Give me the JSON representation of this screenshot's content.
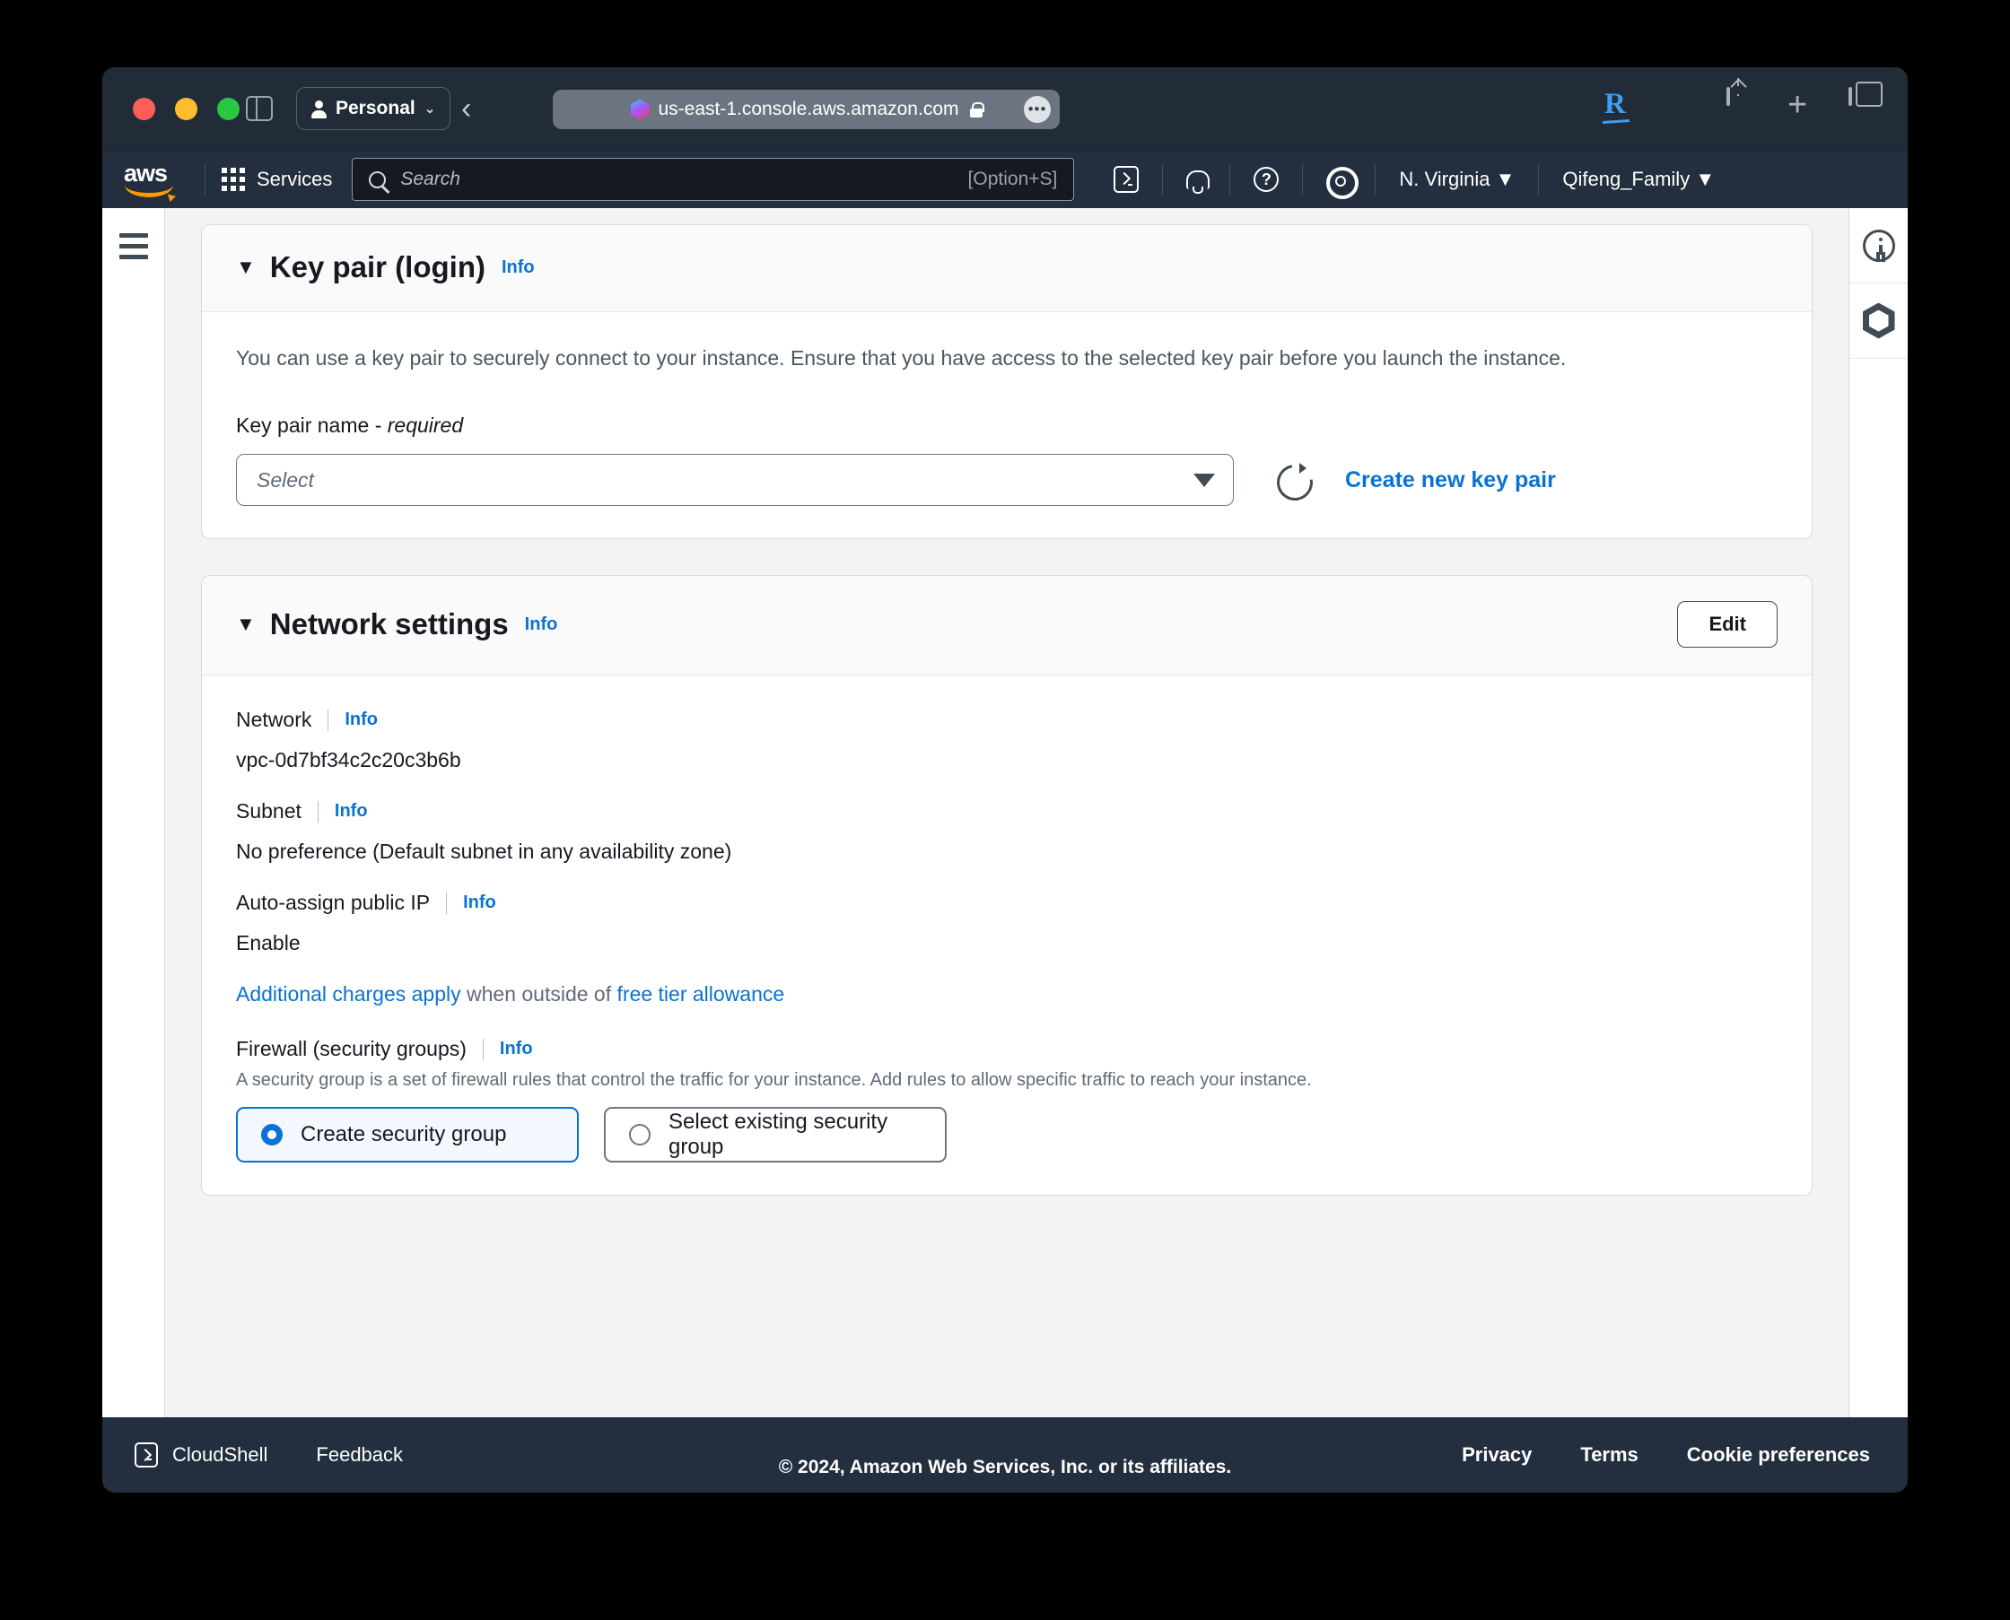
{
  "browser": {
    "profile_label": "Personal",
    "url": "us-east-1.console.aws.amazon.com",
    "actions": [
      "reader-icon",
      "download-shield-icon",
      "share-icon",
      "new-tab-icon",
      "tab-overview-icon"
    ]
  },
  "awsnav": {
    "logo": "aws",
    "services_label": "Services",
    "search_placeholder": "Search",
    "search_shortcut": "[Option+S]",
    "region_label": "N. Virginia",
    "account_label": "Qifeng_Family",
    "caret": "▼"
  },
  "keypair": {
    "caret": "▼",
    "title": "Key pair (login)",
    "info_label": "Info",
    "description": "You can use a key pair to securely connect to your instance. Ensure that you have access to the selected key pair before you launch the instance.",
    "field_label_text": "Key pair name -",
    "field_label_required": "required",
    "select_placeholder": "Select",
    "create_link": "Create new key pair"
  },
  "network": {
    "caret": "▼",
    "title": "Network settings",
    "info_label": "Info",
    "edit_label": "Edit",
    "network_label": "Network",
    "network_info": "Info",
    "network_value": "vpc-0d7bf34c2c20c3b6b",
    "subnet_label": "Subnet",
    "subnet_info": "Info",
    "subnet_value": "No preference (Default subnet in any availability zone)",
    "autoip_label": "Auto-assign public IP",
    "autoip_info": "Info",
    "autoip_value": "Enable",
    "charges_link": "Additional charges apply",
    "charges_mid": " when outside of ",
    "charges_link2": "free tier allowance",
    "firewall_label": "Firewall (security groups)",
    "firewall_info": "Info",
    "firewall_desc": "A security group is a set of firewall rules that control the traffic for your instance. Add rules to allow specific traffic to reach your instance.",
    "option_create": "Create security group",
    "option_select": "Select existing security group"
  },
  "footer": {
    "cloudshell": "CloudShell",
    "feedback": "Feedback",
    "privacy": "Privacy",
    "terms": "Terms",
    "cookies": "Cookie preferences",
    "copyright": "© 2024, Amazon Web Services, Inc. or its affiliates."
  },
  "colors": {
    "aws_navy": "#232f3e",
    "link_blue": "#0972d3",
    "accent_orange": "#ff9900"
  }
}
